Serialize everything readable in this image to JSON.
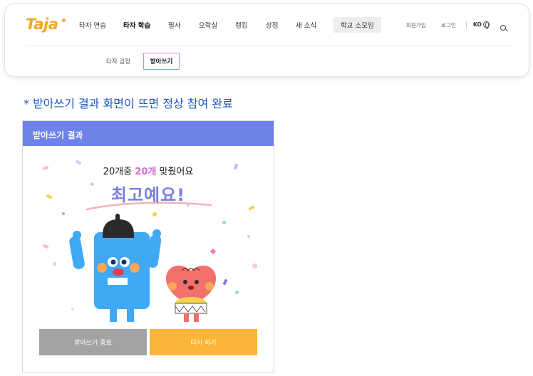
{
  "brand": {
    "logo_text": "Taja",
    "color": "#f5a623"
  },
  "nav": {
    "items": [
      "타자 연습",
      "타자 학습",
      "필사",
      "오락실",
      "랭킹",
      "상점",
      "새 소식",
      "학교 소모임"
    ],
    "active_index": 1
  },
  "util": {
    "signup": "회원가입",
    "login": "로그인",
    "language": "KO",
    "language_icon": "globe-icon",
    "search_icon": "search-icon"
  },
  "subnav": {
    "items": [
      "타자 검정",
      "받아쓰기"
    ],
    "active_index": 1,
    "active_border_color": "#f07cc6"
  },
  "notice": "* 받아쓰기 결과 화면이 뜨면 정상 참여 완료",
  "result": {
    "title": "받아쓰기 결과",
    "score_prefix": "20개중",
    "score_value": "20개",
    "score_suffix": "맞췄어요",
    "praise": "최고예요!",
    "header_color": "#6d83e8",
    "buttons": {
      "end": "받아쓰기 종료",
      "retry": "다시 하기"
    }
  }
}
